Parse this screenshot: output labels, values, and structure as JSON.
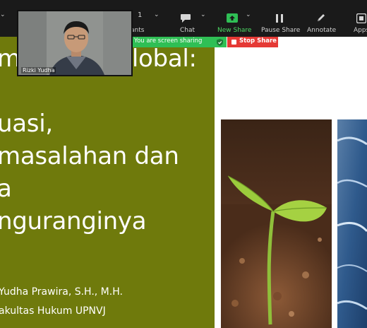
{
  "toolbar": {
    "participants_count": "1",
    "participants_label": "ants",
    "chat_label": "Chat",
    "new_share_label": "New Share",
    "pause_share_label": "Pause Share",
    "annotate_label": "Annotate",
    "apps_label": "Apps"
  },
  "share_bar": {
    "status_text": "You are screen sharing",
    "stop_label": "Stop Share"
  },
  "video": {
    "participant_name": "Rizki Yudha"
  },
  "slide": {
    "title_lines": [
      "manasan Global:",
      "",
      "uasi,",
      "masalahan dan",
      "a",
      "nguranginya"
    ],
    "author": "Yudha Prawira, S.H., M.H.",
    "affiliation": "akultas Hukum UPNVJ"
  },
  "colors": {
    "slide_green": "#6f7a0c",
    "toolbar_bg": "#1a1a1a",
    "share_green": "#2fbf55",
    "stop_red": "#e53935"
  }
}
